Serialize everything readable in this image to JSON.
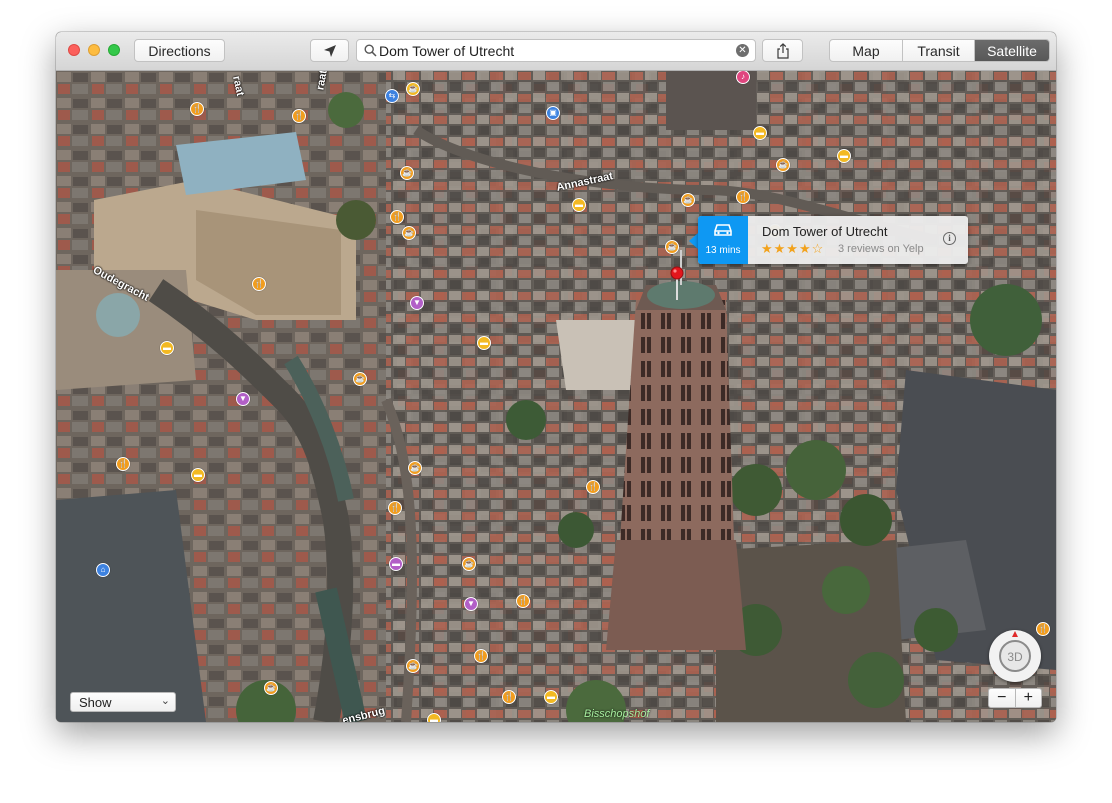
{
  "toolbar": {
    "directions_label": "Directions",
    "search_value": "Dom Tower of Utrecht",
    "tabs": [
      {
        "label": "Map",
        "selected": false
      },
      {
        "label": "Transit",
        "selected": false
      },
      {
        "label": "Satellite",
        "selected": true
      }
    ]
  },
  "callout": {
    "eta": "13 mins",
    "title": "Dom Tower of Utrecht",
    "stars": "★★★★☆",
    "rating": 4.5,
    "reviews": "3 reviews on Yelp"
  },
  "map": {
    "labels": {
      "annastraat": "Annastraat",
      "oudegracht": "Oudegracht",
      "top_street_1": "raat",
      "top_street_2": "raat",
      "bottom_street": "ensbrug",
      "park": "Bisschopshof"
    },
    "show_label": "Show",
    "compass_label": "3D",
    "zoom_out": "−",
    "zoom_in": "+"
  },
  "colors": {
    "eta_blue": "#0e98f3",
    "star_orange": "#f2a21c",
    "satellite_tab": "#5f5f5f"
  }
}
